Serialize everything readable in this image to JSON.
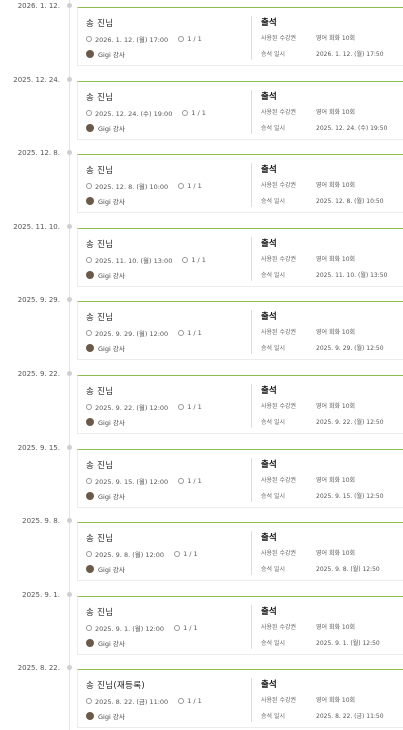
{
  "entries": [
    {
      "date": "2026. 1. 12.",
      "name": "송   진님",
      "datetime": "2026. 1. 12. (월) 17:00",
      "count": "1 / 1",
      "teacher": "Gigi 강사",
      "status": "출석",
      "ticket_label": "사용된 수강권",
      "ticket_value": "영어 회화 10회",
      "approval_label": "승석 일시",
      "approval_value": "2026. 1. 12. (월) 17:50"
    },
    {
      "date": "2025. 12. 24.",
      "name": "송   진님",
      "datetime": "2025. 12. 24. (수) 19:00",
      "count": "1 / 1",
      "teacher": "Gigi 강사",
      "status": "출석",
      "ticket_label": "사용된 수강권",
      "ticket_value": "영어 회화 10회",
      "approval_label": "승석 일시",
      "approval_value": "2025. 12. 24. (수) 19:50"
    },
    {
      "date": "2025. 12. 8.",
      "name": "송   진님",
      "datetime": "2025. 12. 8. (월) 10:00",
      "count": "1 / 1",
      "teacher": "Gigi 강사",
      "status": "출석",
      "ticket_label": "사용된 수강권",
      "ticket_value": "영어 회화 10회",
      "approval_label": "승석 일시",
      "approval_value": "2025. 12. 8. (월) 10:50"
    },
    {
      "date": "2025. 11. 10.",
      "name": "송   진님",
      "datetime": "2025. 11. 10. (월) 13:00",
      "count": "1 / 1",
      "teacher": "Gigi 강사",
      "status": "출석",
      "ticket_label": "사용된 수강권",
      "ticket_value": "영어 회화 10회",
      "approval_label": "승석 일시",
      "approval_value": "2025. 11. 10. (월) 13:50"
    },
    {
      "date": "2025. 9. 29.",
      "name": "송   진님",
      "datetime": "2025. 9. 29. (월) 12:00",
      "count": "1 / 1",
      "teacher": "Gigi 강사",
      "status": "출석",
      "ticket_label": "사용된 수강권",
      "ticket_value": "영어 회화 10회",
      "approval_label": "승석 일시",
      "approval_value": "2025. 9. 29. (월) 12:50"
    },
    {
      "date": "2025. 9. 22.",
      "name": "송   진님",
      "datetime": "2025. 9. 22. (월) 12:00",
      "count": "1 / 1",
      "teacher": "Gigi 강사",
      "status": "출석",
      "ticket_label": "사용된 수강권",
      "ticket_value": "영어 회화 10회",
      "approval_label": "승석 일시",
      "approval_value": "2025. 9. 22. (월) 12:50"
    },
    {
      "date": "2025. 9. 15.",
      "name": "송   진님",
      "datetime": "2025. 9. 15. (월) 12:00",
      "count": "1 / 1",
      "teacher": "Gigi 강사",
      "status": "출석",
      "ticket_label": "사용된 수강권",
      "ticket_value": "영어 회화 10회",
      "approval_label": "승석 일시",
      "approval_value": "2025. 9. 15. (월) 12:50"
    },
    {
      "date": "2025. 9. 8.",
      "name": "송   진님",
      "datetime": "2025. 9. 8. (월) 12:00",
      "count": "1 / 1",
      "teacher": "Gigi 강사",
      "status": "출석",
      "ticket_label": "사용된 수강권",
      "ticket_value": "영어 회화 10회",
      "approval_label": "승석 일시",
      "approval_value": "2025. 9. 8. (월) 12:50"
    },
    {
      "date": "2025. 9. 1.",
      "name": "송   진님",
      "datetime": "2025. 9. 1. (월) 12:00",
      "count": "1 / 1",
      "teacher": "Gigi 강사",
      "status": "출석",
      "ticket_label": "사용된 수강권",
      "ticket_value": "영어 회화 10회",
      "approval_label": "승석 일시",
      "approval_value": "2025. 9. 1. (월) 12:50"
    },
    {
      "date": "2025. 8. 22.",
      "name": "송   진님(재등록)",
      "datetime": "2025. 8. 22. (금) 11:00",
      "count": "1 / 1",
      "teacher": "Gigi 강사",
      "status": "출석",
      "ticket_label": "사용된 수강권",
      "ticket_value": "영어 회화 10회",
      "approval_label": "승석 일시",
      "approval_value": "2025. 8. 22. (금) 11:50"
    }
  ],
  "colors": {
    "accent": "#8cc04a",
    "line": "#e3e3e3"
  },
  "icons": {
    "time": "clock-icon",
    "count": "person-icon",
    "teacher": "avatar"
  }
}
